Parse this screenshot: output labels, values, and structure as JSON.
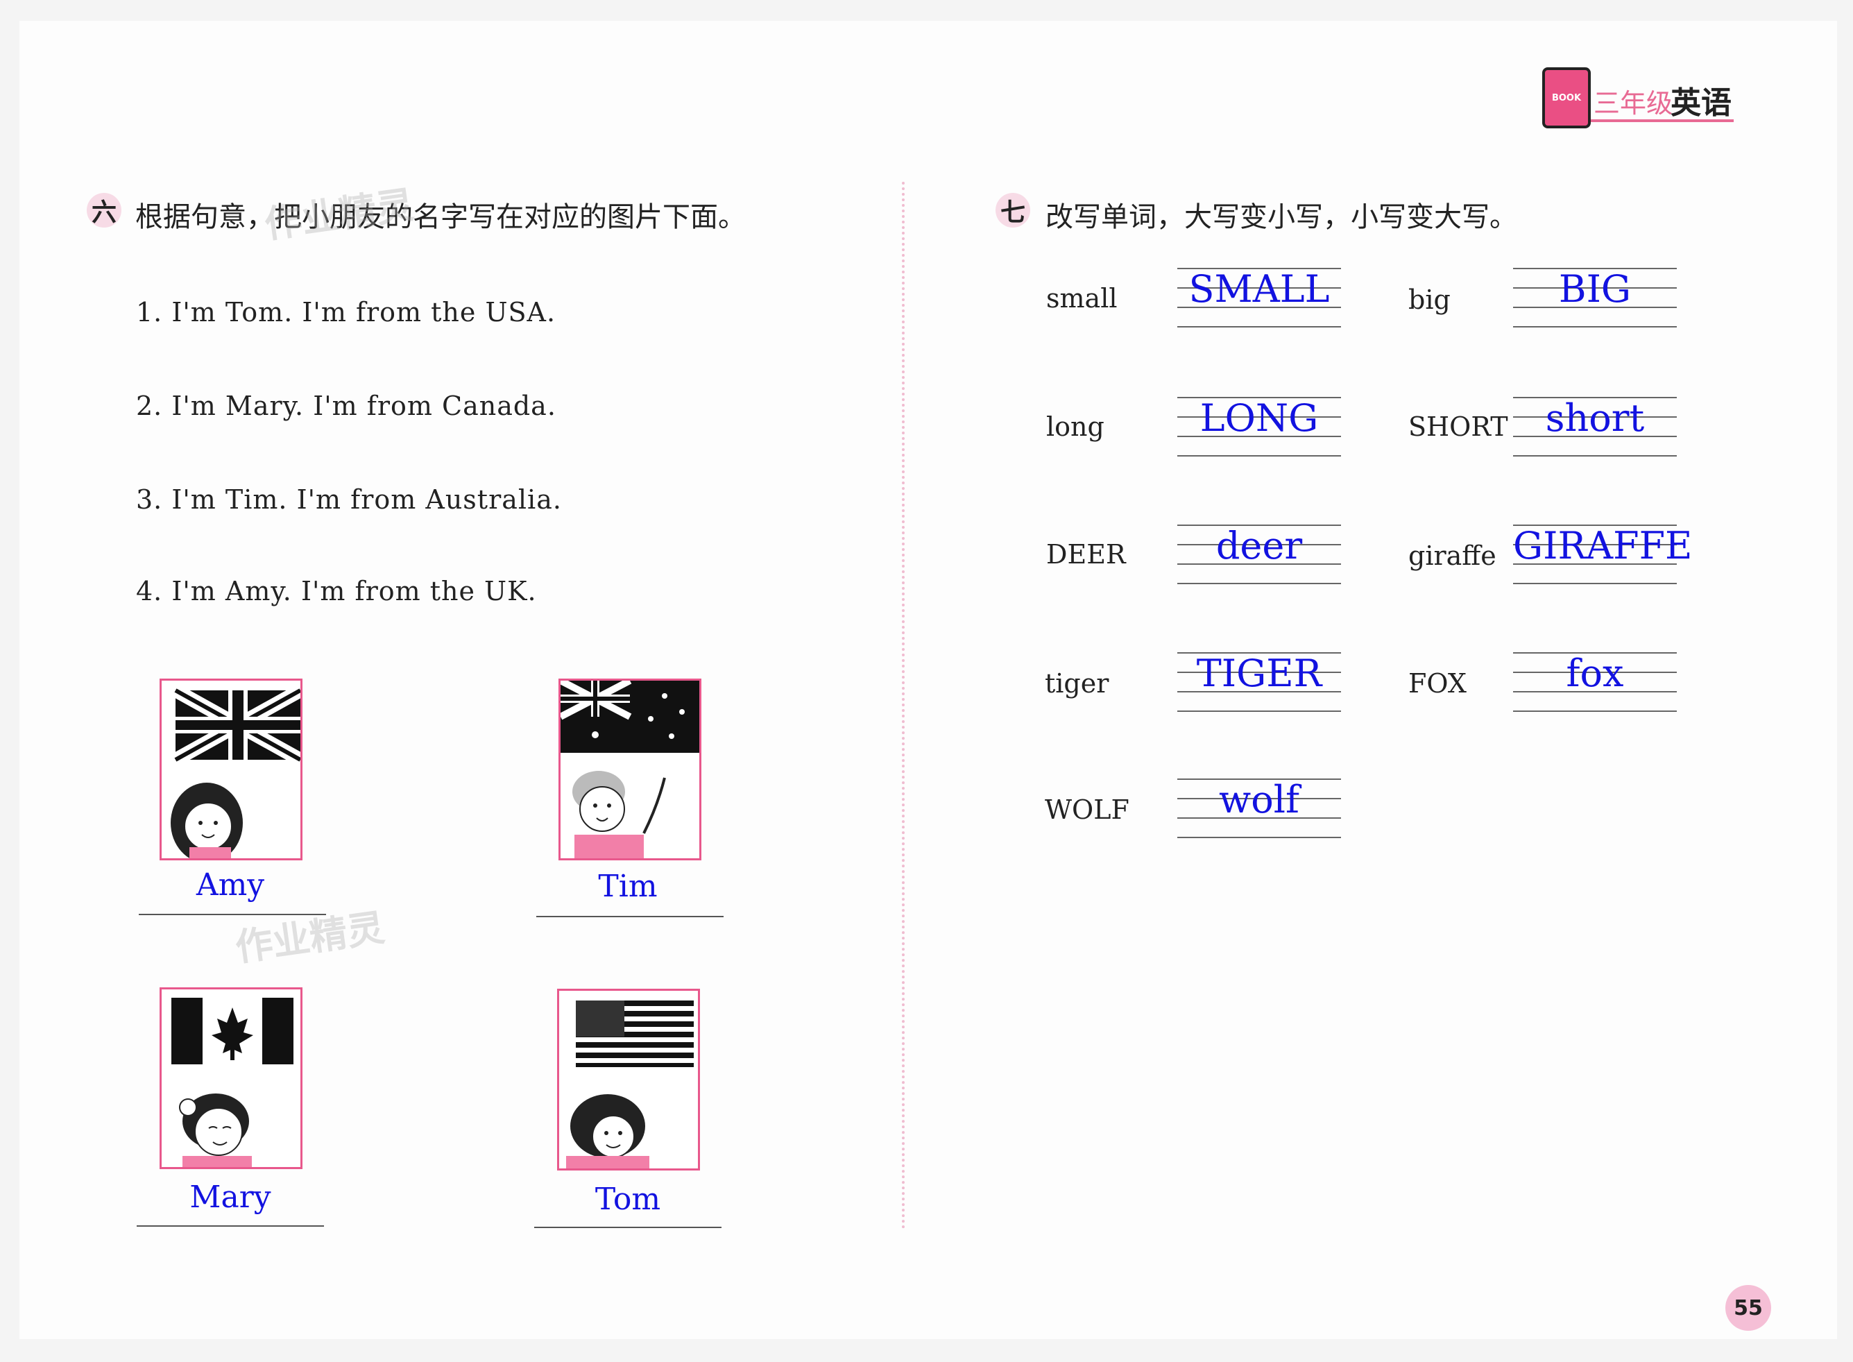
{
  "header": {
    "badge_text": "BOOK",
    "grade": "三年级",
    "subject": "英语"
  },
  "section6": {
    "number": "六",
    "title": "根据句意，把小朋友的名字写在对应的图片下面。",
    "sentences": [
      "1. I'm Tom. I'm from the USA.",
      "2. I'm Mary. I'm from Canada.",
      "3. I'm Tim. I'm from Australia.",
      "4. I'm Amy. I'm from the UK."
    ],
    "pictures": [
      {
        "flag": "uk-flag-icon",
        "answer": "Amy"
      },
      {
        "flag": "australia-flag-icon",
        "answer": "Tim"
      },
      {
        "flag": "canada-flag-icon",
        "answer": "Mary"
      },
      {
        "flag": "usa-flag-icon",
        "answer": "Tom"
      }
    ]
  },
  "section7": {
    "number": "七",
    "title": "改写单词，大写变小写，小写变大写。",
    "words": [
      {
        "word": "small",
        "answer": "SMALL"
      },
      {
        "word": "big",
        "answer": "BIG"
      },
      {
        "word": "long",
        "answer": "LONG"
      },
      {
        "word": "SHORT",
        "answer": "short"
      },
      {
        "word": "DEER",
        "answer": "deer"
      },
      {
        "word": "giraffe",
        "answer": "GIRAFFE"
      },
      {
        "word": "tiger",
        "answer": "TIGER"
      },
      {
        "word": "FOX",
        "answer": "fox"
      },
      {
        "word": "WOLF",
        "answer": "wolf"
      }
    ]
  },
  "watermark": "作业精灵",
  "page_number": "55",
  "colors": {
    "accent_pink": "#e8588c",
    "answer_blue": "#1212e0"
  }
}
